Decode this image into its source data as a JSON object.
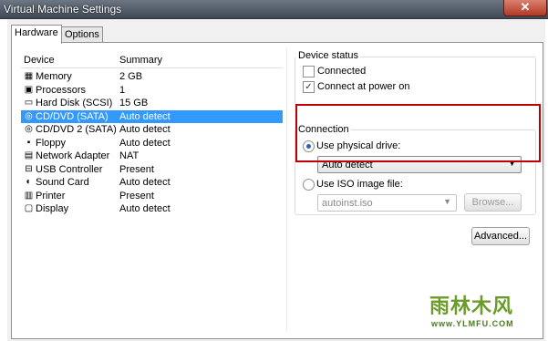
{
  "window": {
    "title": "Virtual Machine Settings",
    "close_glyph": "✕"
  },
  "tabs": [
    {
      "label": "Hardware"
    },
    {
      "label": "Options"
    }
  ],
  "device_list": {
    "headers": {
      "device": "Device",
      "summary": "Summary"
    },
    "rows": [
      {
        "name": "Memory",
        "summary": "2 GB",
        "icon": "memory-icon",
        "glyph": "▦",
        "selected": false
      },
      {
        "name": "Processors",
        "summary": "1",
        "icon": "processor-icon",
        "glyph": "▣",
        "selected": false
      },
      {
        "name": "Hard Disk (SCSI)",
        "summary": "15 GB",
        "icon": "hard-disk-icon",
        "glyph": "▭",
        "selected": false
      },
      {
        "name": "CD/DVD (SATA)",
        "summary": "Auto detect",
        "icon": "cd-dvd-icon",
        "glyph": "◎",
        "selected": true
      },
      {
        "name": "CD/DVD 2 (SATA)",
        "summary": "Auto detect",
        "icon": "cd-dvd-icon",
        "glyph": "◎",
        "selected": false
      },
      {
        "name": "Floppy",
        "summary": "Auto detect",
        "icon": "floppy-icon",
        "glyph": "▪",
        "selected": false
      },
      {
        "name": "Network Adapter",
        "summary": "NAT",
        "icon": "network-adapter-icon",
        "glyph": "▤",
        "selected": false
      },
      {
        "name": "USB Controller",
        "summary": "Present",
        "icon": "usb-controller-icon",
        "glyph": "⊟",
        "selected": false
      },
      {
        "name": "Sound Card",
        "summary": "Auto detect",
        "icon": "sound-card-icon",
        "glyph": "◐",
        "selected": false
      },
      {
        "name": "Printer",
        "summary": "Present",
        "icon": "printer-icon",
        "glyph": "▥",
        "selected": false
      },
      {
        "name": "Display",
        "summary": "Auto detect",
        "icon": "display-icon",
        "glyph": "▢",
        "selected": false
      }
    ]
  },
  "device_status": {
    "title": "Device status",
    "connected": {
      "label": "Connected",
      "checked": false
    },
    "connect_at_power_on": {
      "label": "Connect at power on",
      "checked": true,
      "check_glyph": "✓"
    }
  },
  "connection": {
    "title": "Connection",
    "use_physical_drive": {
      "label": "Use physical drive:",
      "selected": true
    },
    "physical_drive_value": "Auto detect",
    "use_iso": {
      "label": "Use ISO image file:",
      "selected": false
    },
    "iso_value": "autoinst.iso",
    "browse_label": "Browse...",
    "dropdown_glyph": "▼"
  },
  "advanced_label": "Advanced...",
  "watermark": {
    "text": "雨林木风",
    "url": "www.YLMFU.COM"
  },
  "colors": {
    "selection": "#3399ff",
    "highlight_box": "#c00000",
    "title_bar": "#4b5560"
  }
}
